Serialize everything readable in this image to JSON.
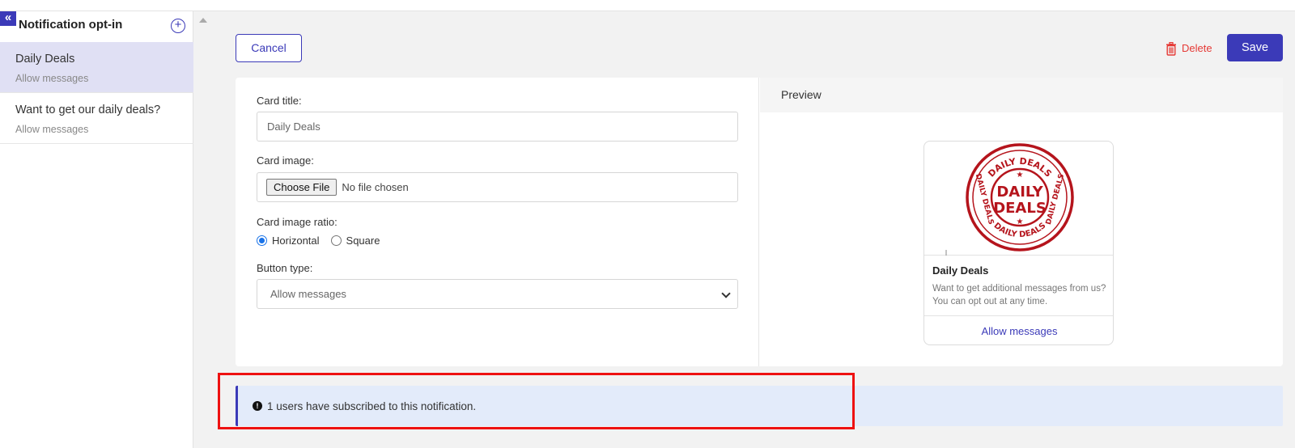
{
  "sidebar": {
    "collapse_icon": "«",
    "title": "Notification opt-in",
    "add_icon": "+",
    "items": [
      {
        "title": "Daily Deals",
        "subtitle": "Allow messages",
        "active": true
      },
      {
        "title": "Want to get our daily deals?",
        "subtitle": "Allow messages",
        "active": false
      }
    ]
  },
  "toolbar": {
    "cancel_label": "Cancel",
    "delete_label": "Delete",
    "save_label": "Save"
  },
  "form": {
    "card_title_label": "Card title:",
    "card_title_value": "Daily Deals",
    "card_image_label": "Card image:",
    "choose_file_label": "Choose File",
    "no_file_text": "No file chosen",
    "ratio_label": "Card image ratio:",
    "ratio_options": [
      "Horizontal",
      "Square"
    ],
    "ratio_selected": "Horizontal",
    "button_type_label": "Button type:",
    "button_type_value": "Allow messages"
  },
  "preview": {
    "header": "Preview",
    "stamp_top": "DAILY DEALS",
    "stamp_bottom": "DAILY DEALS",
    "stamp_left": "DAILY DEALS",
    "stamp_right": "DAILY DEALS",
    "stamp_center_line1": "DAILY",
    "stamp_center_line2": "DEALS",
    "card_title": "Daily Deals",
    "card_description": "Want to get additional messages from us? You can opt out at any time.",
    "card_button": "Allow messages"
  },
  "info": {
    "icon": "!",
    "message": "1 users have subscribed to this notification."
  },
  "colors": {
    "accent": "#3b3ab8",
    "danger": "#e53935",
    "stamp": "#b5141c",
    "highlight": "#ee1111"
  }
}
